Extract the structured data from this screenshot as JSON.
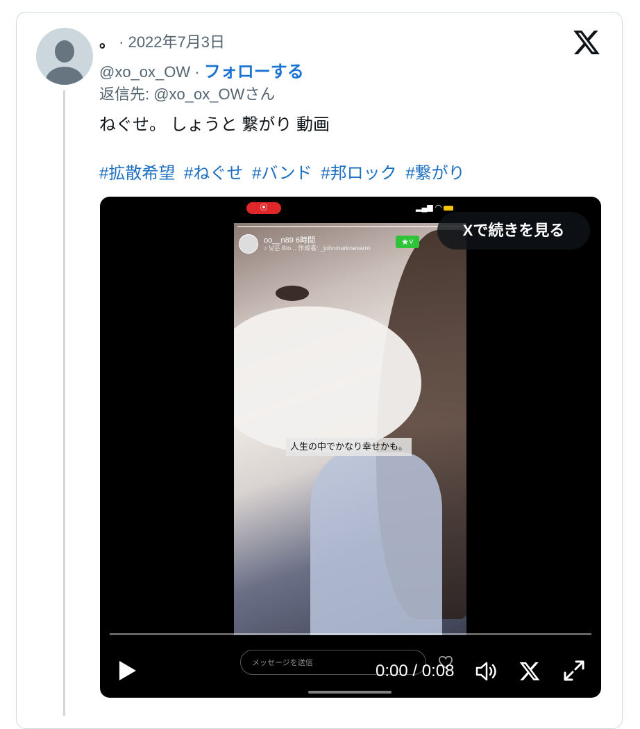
{
  "tweet": {
    "display_name": "。",
    "date": "· 2022年7月3日",
    "handle": "@xo_ox_OW",
    "handle_sep": " · ",
    "follow_label": "フォローする",
    "reply_to": "返信先: @xo_ox_OWさん",
    "text": "ねぐせ。 しょうと 繋がり 動画",
    "hashtags": [
      "#拡散希望",
      "#ねぐせ",
      "#バンド",
      "#邦ロック",
      "#繋がり"
    ]
  },
  "video": {
    "continue_label": "Xで続きを見る",
    "time_display": "0:00 / 0:08",
    "subtitle": "人生の中でかなり幸せかも。",
    "story_user": "oo__n89  6時間",
    "story_sub": "♪ 낮은 Blo... 作成者: _johnmarknavarro",
    "message_placeholder": "メッセージを送信",
    "rec_icon": "record-icon",
    "icons": [
      "play-icon",
      "volume-icon",
      "x-logo-icon",
      "fullscreen-icon"
    ]
  },
  "colors": {
    "link": "#1d6fc2",
    "follow": "#1b74d1",
    "secondary_text": "#536471",
    "border": "#cfd9de"
  }
}
